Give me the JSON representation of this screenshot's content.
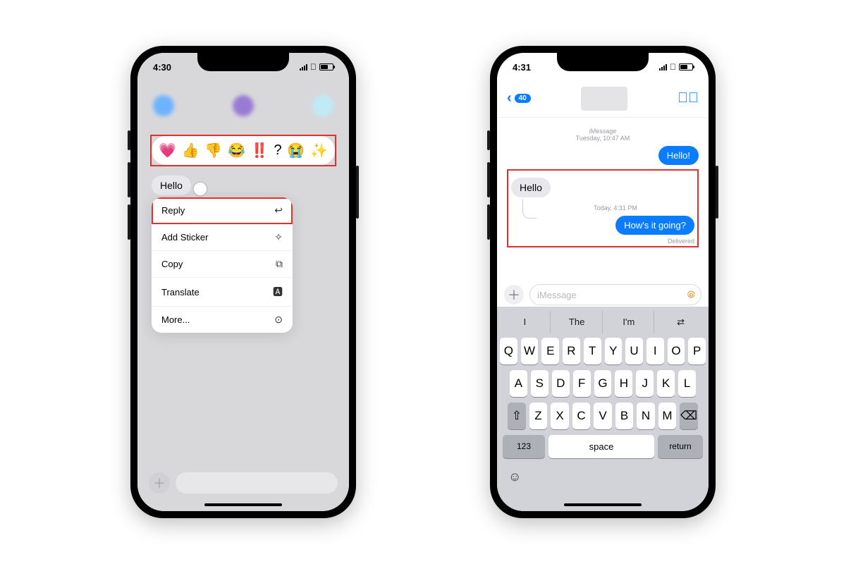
{
  "left": {
    "status_time": "4:30",
    "tapbacks": [
      "💗",
      "👍",
      "👎",
      "😂",
      "‼️",
      "?",
      "😭",
      "✨"
    ],
    "message_text": "Hello",
    "menu": {
      "reply": "Reply",
      "add_sticker": "Add Sticker",
      "copy": "Copy",
      "translate": "Translate",
      "more": "More..."
    }
  },
  "right": {
    "status_time": "4:31",
    "back_badge": "40",
    "timestamp1_line1": "iMessage",
    "timestamp1_line2": "Tuesday, 10:47 AM",
    "msg_hello_out": "Hello!",
    "thread_incoming": "Hello",
    "timestamp2": "Today, 4:31 PM",
    "msg_reply_out": "How's it going?",
    "delivered_label": "Delivered",
    "composer_placeholder": "iMessage",
    "suggestions": [
      "I",
      "The",
      "I'm",
      "⇄"
    ],
    "keys_row1": [
      "Q",
      "W",
      "E",
      "R",
      "T",
      "Y",
      "U",
      "I",
      "O",
      "P"
    ],
    "keys_row2": [
      "A",
      "S",
      "D",
      "F",
      "G",
      "H",
      "J",
      "K",
      "L"
    ],
    "keys_row3": [
      "Z",
      "X",
      "C",
      "V",
      "B",
      "N",
      "M"
    ],
    "key_123": "123",
    "key_space": "space",
    "key_return": "return"
  }
}
